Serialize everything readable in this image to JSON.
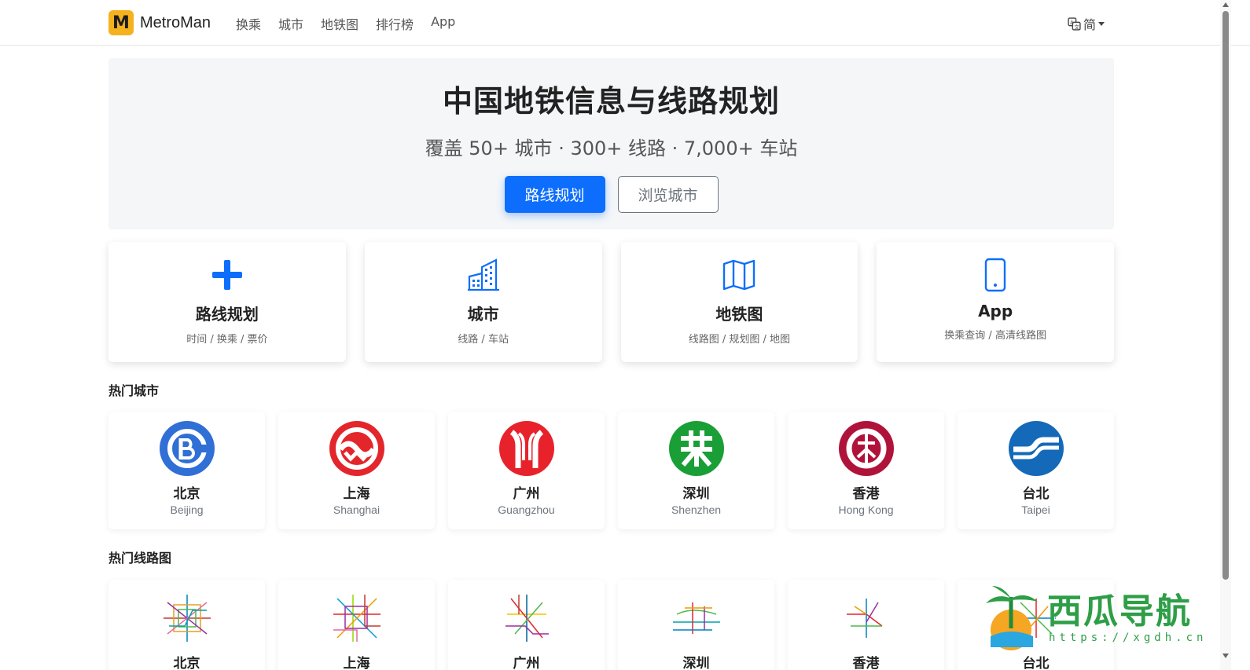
{
  "nav": {
    "brand_logo": "M",
    "brand": "MetroMan",
    "links": [
      "换乘",
      "城市",
      "地铁图",
      "排行榜",
      "App"
    ],
    "lang": "简"
  },
  "hero": {
    "title": "中国地铁信息与线路规划",
    "subtitle": "覆盖 50+ 城市 · 300+ 线路 · 7,000+ 车站",
    "primary_btn": "路线规划",
    "secondary_btn": "浏览城市"
  },
  "features": [
    {
      "icon": "plus-icon",
      "title": "路线规划",
      "desc": "时间 / 换乘 / 票价"
    },
    {
      "icon": "buildings-icon",
      "title": "城市",
      "desc": "线路 / 车站"
    },
    {
      "icon": "map-icon",
      "title": "地铁图",
      "desc": "线路图 / 规划图 / 地图"
    },
    {
      "icon": "phone-icon",
      "title": "App",
      "desc": "换乘查询 / 高清线路图"
    }
  ],
  "hot_cities_title": "热门城市",
  "cities": [
    {
      "name": "北京",
      "en": "Beijing",
      "color": "#2f6fd6"
    },
    {
      "name": "上海",
      "en": "Shanghai",
      "color": "#e3262b"
    },
    {
      "name": "广州",
      "en": "Guangzhou",
      "color": "#e8222b"
    },
    {
      "name": "深圳",
      "en": "Shenzhen",
      "color": "#1a9e36"
    },
    {
      "name": "香港",
      "en": "Hong Kong",
      "color": "#b0133a"
    },
    {
      "name": "台北",
      "en": "Taipei",
      "color": "#1469b8"
    }
  ],
  "hot_maps_title": "热门线路图",
  "maps": [
    {
      "name": "北京"
    },
    {
      "name": "上海"
    },
    {
      "name": "广州"
    },
    {
      "name": "深圳"
    },
    {
      "name": "香港"
    },
    {
      "name": "台北"
    }
  ],
  "watermark": {
    "text": "西瓜导航",
    "url": "https://xgdh.cn"
  }
}
